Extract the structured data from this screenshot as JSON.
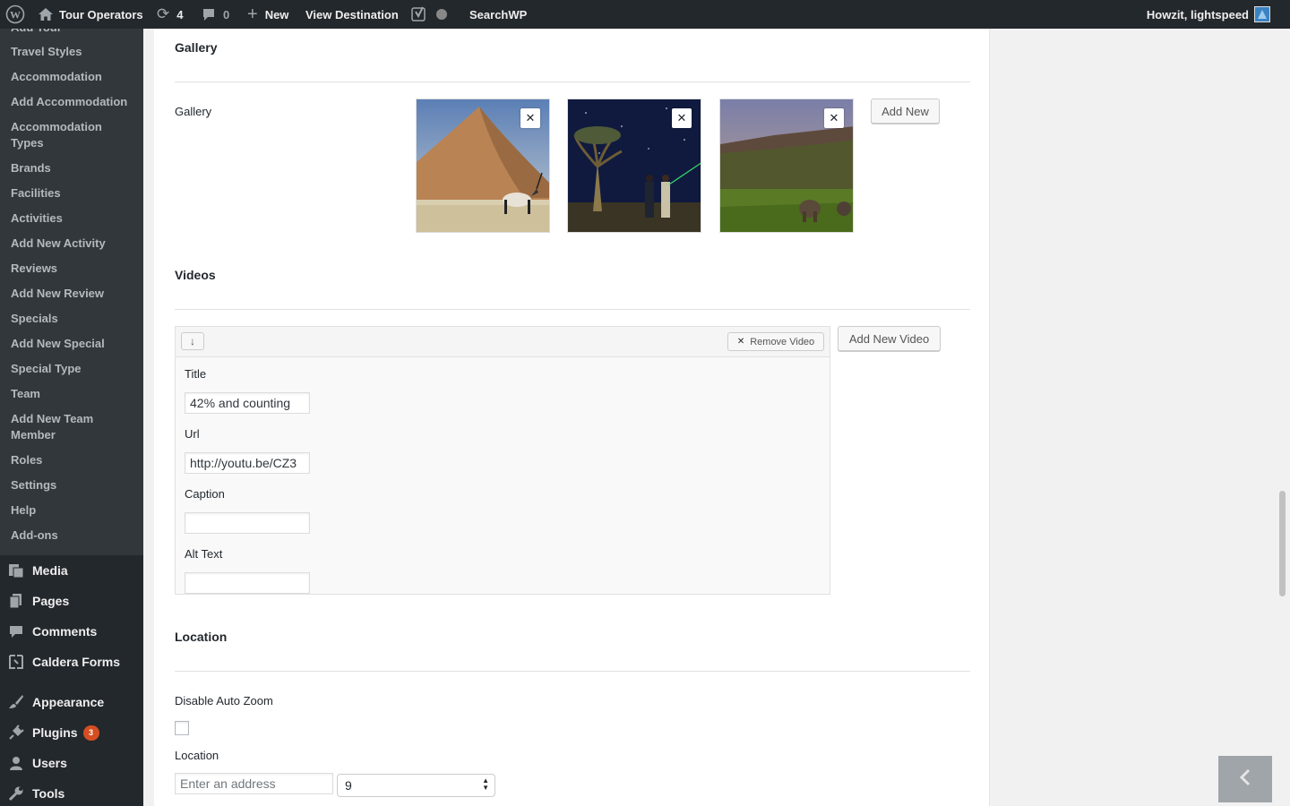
{
  "adminbar": {
    "site_name": "Tour Operators",
    "updates_count": "4",
    "comments_count": "0",
    "new_label": "New",
    "view_label": "View Destination",
    "searchwp_label": "SearchWP",
    "greeting": "Howzit, lightspeed"
  },
  "sidebar": {
    "submenu": [
      {
        "label": "Add Tour"
      },
      {
        "label": "Travel Styles"
      },
      {
        "label": "Accommodation"
      },
      {
        "label": "Add Accommodation"
      },
      {
        "label": "Accommodation Types"
      },
      {
        "label": "Brands"
      },
      {
        "label": "Facilities"
      },
      {
        "label": "Activities"
      },
      {
        "label": "Add New Activity"
      },
      {
        "label": "Reviews"
      },
      {
        "label": "Add New Review"
      },
      {
        "label": "Specials"
      },
      {
        "label": "Add New Special"
      },
      {
        "label": "Special Type"
      },
      {
        "label": "Team"
      },
      {
        "label": "Add New Team Member"
      },
      {
        "label": "Roles"
      },
      {
        "label": "Settings"
      },
      {
        "label": "Help"
      },
      {
        "label": "Add-ons"
      }
    ],
    "menu": [
      {
        "label": "Media",
        "icon": "media-icon"
      },
      {
        "label": "Pages",
        "icon": "pages-icon"
      },
      {
        "label": "Comments",
        "icon": "comments-icon"
      },
      {
        "label": "Caldera Forms",
        "icon": "caldera-icon"
      },
      {
        "label": "Appearance",
        "icon": "brush-icon"
      },
      {
        "label": "Plugins",
        "icon": "plug-icon",
        "badge": "3"
      },
      {
        "label": "Users",
        "icon": "user-icon"
      },
      {
        "label": "Tools",
        "icon": "wrench-icon"
      }
    ]
  },
  "gallery": {
    "section_title": "Gallery",
    "field_label": "Gallery",
    "add_new_label": "Add New",
    "images": [
      {
        "alt": "oryx-dune-photo"
      },
      {
        "alt": "quiver-tree-night-photo"
      },
      {
        "alt": "elephants-plateau-photo"
      }
    ]
  },
  "videos": {
    "section_title": "Videos",
    "remove_label": "Remove Video",
    "add_label": "Add New Video",
    "fields": {
      "title_label": "Title",
      "title_value": "42% and counting",
      "url_label": "Url",
      "url_value": "http://youtu.be/CZ3",
      "caption_label": "Caption",
      "caption_value": "",
      "alt_label": "Alt Text",
      "alt_value": ""
    }
  },
  "location": {
    "section_title": "Location",
    "disable_zoom_label": "Disable Auto Zoom",
    "location_label": "Location",
    "address_placeholder": "Enter an address",
    "zoom_value": "9"
  },
  "colors": {
    "adminbar_bg": "#23282d",
    "submenu_bg": "#32373c",
    "badge": "#d54e21"
  }
}
